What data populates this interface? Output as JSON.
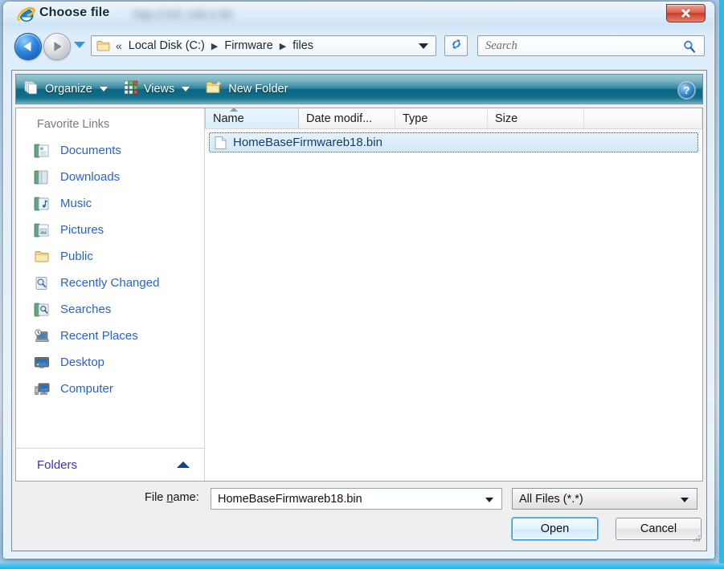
{
  "window": {
    "title": "Choose file",
    "title_icon": "internet-explorer-icon",
    "blurred_url": "http://192.168.0.80",
    "close_label": ""
  },
  "nav": {
    "back_icon": "back-arrow-icon",
    "forward_icon": "forward-arrow-icon",
    "recent_pages_icon": "chevron-down-icon",
    "folder_icon": "folder-icon",
    "overflow": "«",
    "breadcrumbs": [
      "Local Disk (C:)",
      "Firmware",
      "files"
    ],
    "separator": "▶",
    "dropdown_icon": "chevron-down-icon",
    "refresh_icon": "refresh-icon"
  },
  "search": {
    "placeholder": "Search",
    "icon": "search-icon"
  },
  "toolbar": {
    "organize_label": "Organize",
    "organize_icon": "stacked-pages-icon",
    "views_label": "Views",
    "views_icon": "grid-view-icon",
    "new_folder_label": "New Folder",
    "new_folder_icon": "new-folder-icon",
    "help_label": "?",
    "help_icon": "help-icon"
  },
  "sidebar": {
    "header": "Favorite Links",
    "items": [
      {
        "label": "Documents",
        "icon": "documents-folder-icon"
      },
      {
        "label": "Downloads",
        "icon": "downloads-folder-icon"
      },
      {
        "label": "Music",
        "icon": "music-folder-icon"
      },
      {
        "label": "Pictures",
        "icon": "pictures-folder-icon"
      },
      {
        "label": "Public",
        "icon": "public-folder-icon"
      },
      {
        "label": "Recently Changed",
        "icon": "recently-changed-icon"
      },
      {
        "label": "Searches",
        "icon": "searches-icon"
      },
      {
        "label": "Recent Places",
        "icon": "recent-places-icon"
      },
      {
        "label": "Desktop",
        "icon": "desktop-icon"
      },
      {
        "label": "Computer",
        "icon": "computer-icon"
      }
    ],
    "folders_label": "Folders",
    "folders_chevron": "chevron-up-icon"
  },
  "filelist": {
    "columns": [
      {
        "label": "Name",
        "width": 117,
        "sorted": true
      },
      {
        "label": "Date modif...",
        "width": 120,
        "sorted": false
      },
      {
        "label": "Type",
        "width": 115,
        "sorted": false
      },
      {
        "label": "Size",
        "width": 120,
        "sorted": false
      },
      {
        "label": "",
        "width": 151,
        "sorted": false
      }
    ],
    "sort_icon": "sort-ascending-icon",
    "rows": [
      {
        "name": "HomeBaseFirmwareb18.bin",
        "date_modified": "",
        "type": "",
        "size": "",
        "icon": "generic-file-icon",
        "selected": true
      }
    ]
  },
  "footer": {
    "filename_label_before": "File ",
    "filename_label_accel": "n",
    "filename_label_after": "ame:",
    "filename_value": "HomeBaseFirmwareb18.bin",
    "filename_placeholder": "",
    "filter_value": "All Files (*.*)",
    "filter_options": [
      "All Files (*.*)"
    ],
    "open_label": "Open",
    "cancel_label": "Cancel",
    "resize_grip_icon": "resize-grip-icon"
  },
  "colors": {
    "accent_blue": "#2a63c8",
    "toolbar_teal_dark": "#0c6581",
    "toolbar_teal_light": "#9fc9d3",
    "close_red": "#c73b29",
    "selection_blue": "#d2e9f8",
    "default_button_glow": "#6cc2f2"
  }
}
